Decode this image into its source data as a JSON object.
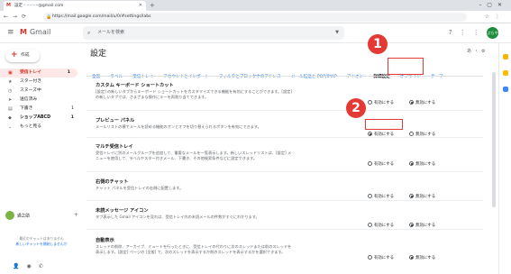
{
  "browser": {
    "tab_title": "設定 - ·········@gmail.com",
    "tab_favicon": "M",
    "url": "https://mail.google.com/mail/u/0/#settings/labs"
  },
  "gmail": {
    "logo_text": "Gmail",
    "search_placeholder": "メールを検索",
    "avatar_initials": "ぷらや",
    "compose_label": "作成"
  },
  "sidebar": {
    "items": [
      {
        "label": "受信トレイ",
        "count": "1",
        "active": true,
        "icon": "inbox-icon"
      },
      {
        "label": "スター付き",
        "count": "",
        "active": false,
        "icon": "star-icon"
      },
      {
        "label": "スヌーズ中",
        "count": "",
        "active": false,
        "icon": "clock-icon"
      },
      {
        "label": "送信済み",
        "count": "",
        "active": false,
        "icon": "send-icon"
      },
      {
        "label": "下書き",
        "count": "1",
        "active": false,
        "icon": "draft-icon"
      },
      {
        "label": "ショップABCD",
        "count": "1",
        "active": false,
        "icon": "label-icon"
      },
      {
        "label": "もっと見る",
        "count": "",
        "active": false,
        "icon": "chevron-down-icon"
      }
    ],
    "chat_user": "通之助",
    "chat_empty_text": "最近のチャットはありません",
    "chat_start_link": "新しいチャットを開始しませんか"
  },
  "settings": {
    "title": "設定",
    "title_right": "あ・⚙",
    "tabs": [
      "全般",
      "ラベル",
      "受信トレイ",
      "アカウントとインポート",
      "フィルタとブロック中のアドレス",
      "メール転送と POP/IMAP",
      "アドオン",
      "詳細設定",
      "オフライン",
      "テーマ"
    ],
    "current_tab_index": 7,
    "sections": [
      {
        "heading": "カスタム キーボード ショートカット",
        "desc1": "[設定] の新しいタブからキーボード ショートカットをカスタマイズできる機能を有効にすることができます。[設定]",
        "desc2": "の新しいタブでは、さまざまな操作にキーを再割り当てできます。",
        "enable": "有効にする",
        "disable": "無効にする",
        "selected": "disable"
      },
      {
        "heading": "プレビュー パネル",
        "desc1": "メールリストの横でメールを読める機能のオンとオフを切り替えられるボタンを有効にできます。",
        "desc2": "",
        "enable": "有効にする",
        "disable": "無効にする",
        "selected": "enable"
      },
      {
        "heading": "マルチ受信トレイ",
        "desc1": "受信トレイに別のメールグループを追加して、重要なメールを一覧表示します。新しいスレッドリストは、[設定] メ",
        "desc2": "ニューを使用して、ラベルやスター付きメール、下書き、その他検索条件などに設定できます。",
        "enable": "有効にする",
        "disable": "無効にする",
        "selected": "disable"
      },
      {
        "heading": "右側のチャット",
        "desc1": "チャット パネルを受信トレイの右側に配置します。",
        "desc2": "",
        "enable": "有効にする",
        "disable": "無効にする",
        "selected": "disable"
      },
      {
        "heading": "未読メッセージ アイコン",
        "desc1": "タブ表示した Gmail アイコンを見れば、受信トレイ内の未読メールの件数がすぐにわかります。",
        "desc2": "",
        "enable": "有効にする",
        "disable": "無効にする",
        "selected": "disable"
      },
      {
        "heading": "自動表示",
        "desc1": "スレッドの削除、アーカイブ、ミュートを行ったときに、受信トレイの代わりに次のスレッドまたは前のスレッドを",
        "desc2": "表示します。[設定] ページの [全般] で、次のスレッドを表示するか前のスレッドを表示するかを選択できます。",
        "enable": "有効にする",
        "disable": "無効にする",
        "selected": "disable"
      }
    ]
  },
  "callouts": {
    "one": "1",
    "two": "2"
  },
  "colors": {
    "accent_red": "#e53935",
    "link_blue": "#1a73e8",
    "gmail_red": "#d93025"
  }
}
